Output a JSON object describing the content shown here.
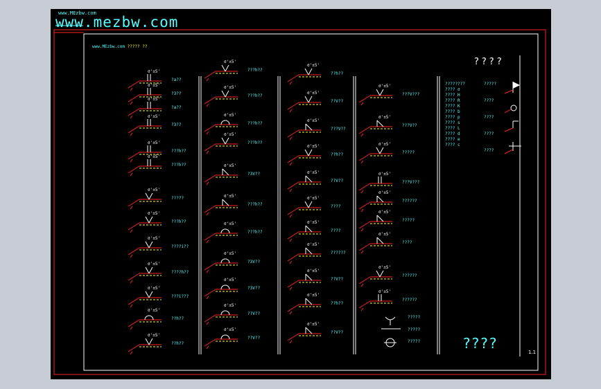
{
  "watermark": {
    "small": "www.MEzbw.com",
    "big": "www.mezbw.com"
  },
  "inner_title": {
    "site": "www.MEzbw.com",
    "rest": "  ?????  ??"
  },
  "header_q": "????",
  "footer_q": "????",
  "page_no": "1.1",
  "legend": {
    "left": [
      "????????",
      "???? σ",
      "???? H",
      "???? R",
      "???? K",
      "???? b",
      "???? p",
      "???? s",
      "???? L",
      "???? d",
      "???? e",
      "???? c"
    ],
    "right": [
      "?????",
      "????",
      "????",
      "????",
      "????"
    ]
  },
  "marks": [
    "?a??",
    "?3??",
    "?a??",
    "?3??",
    "???h??",
    "???h??",
    "?????",
    "???h??",
    "????i??",
    "????h??",
    "???i???",
    "??h??",
    "??h??",
    "???h??",
    "???h??",
    "???h??",
    "???h??",
    "?3V??",
    "???h??",
    "???h??",
    "?3V??",
    "?3V??",
    "??V??",
    "??V??",
    "??h??",
    "??V??",
    "???V??",
    "??h??",
    "??V??",
    "????",
    "????",
    "??????",
    "??V??",
    "??h??",
    "??V??",
    "???V???",
    "???V??",
    "?????",
    "???V???",
    "??????",
    "?????",
    "????",
    "??????",
    "??????",
    "?????",
    "?????",
    "?????",
    "???",
    "??????",
    "??????",
    "???"
  ]
}
